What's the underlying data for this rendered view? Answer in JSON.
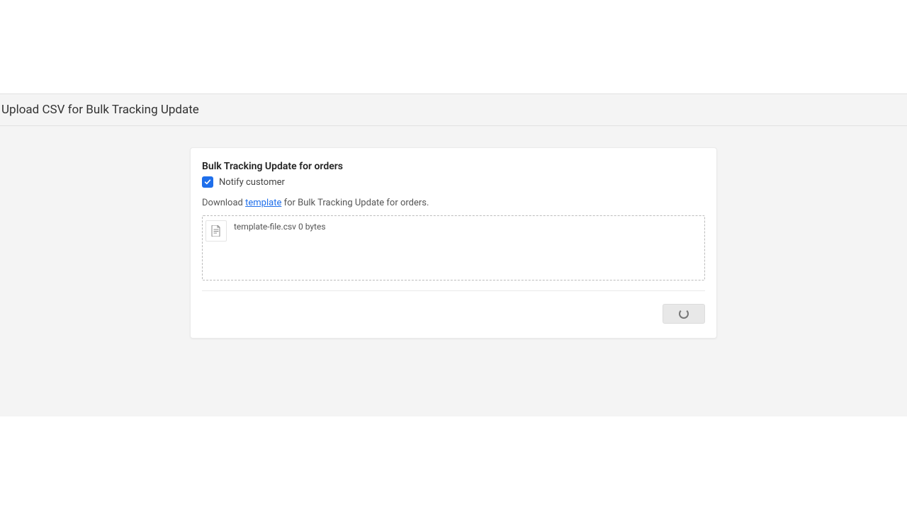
{
  "header": {
    "title": "Upload CSV for Bulk Tracking Update"
  },
  "card": {
    "title": "Bulk Tracking Update for orders",
    "notify_customer_label": "Notify customer",
    "notify_customer_checked": true,
    "download_prefix": "Download ",
    "download_link_text": "template",
    "download_suffix": " for Bulk Tracking Update for orders."
  },
  "file": {
    "name": "template-file.csv",
    "size": "0 bytes"
  },
  "footer": {
    "submit_state": "loading"
  }
}
